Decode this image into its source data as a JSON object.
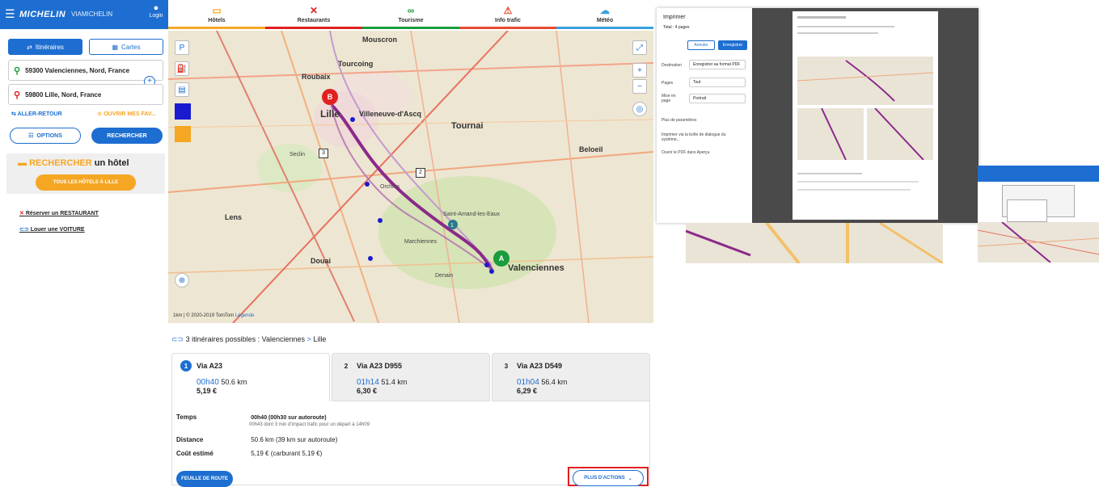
{
  "header": {
    "menu_icon": "hamburger-icon",
    "brand": "MICHELIN",
    "brand_suffix": "VIAMICHELIN",
    "login": "Login"
  },
  "mode_tabs": [
    {
      "label": "Itinéraires",
      "icon": "route-icon"
    },
    {
      "label": "Cartes",
      "icon": "map-icon"
    }
  ],
  "from": "59300 Valenciennes, Nord, France",
  "to": "59800 Lille, Nord, France",
  "roundtrip": "ALLER-RETOUR",
  "open_favorites": "OUVRIR MES FAV...",
  "options": "OPTIONS",
  "search": "RECHERCHER",
  "hotel": {
    "prefix": "RECHERCHER",
    "suffix": "un hôtel",
    "button": "TOUS LES HÔTELS À LILLE"
  },
  "links": [
    {
      "label": "Réserver un RESTAURANT",
      "icon": "restaurant-icon"
    },
    {
      "label": "Louer une VOITURE",
      "icon": "car-icon"
    }
  ],
  "nav": [
    {
      "label": "Hôtels",
      "color": "#f5a623"
    },
    {
      "label": "Restaurants",
      "color": "#e02020"
    },
    {
      "label": "Tourisme",
      "color": "#1a9c3c"
    },
    {
      "label": "Info trafic",
      "color": "#e84a2f"
    },
    {
      "label": "Météo",
      "color": "#3aa0e0"
    }
  ],
  "map_labels": {
    "mouscron": "Mouscron",
    "tourcoing": "Tourcoing",
    "roubaix": "Roubaix",
    "lille": "Lille",
    "villeneuve": "Villeneuve-d'Ascq",
    "tournai": "Tournai",
    "beloeil": "Beloeil",
    "valenciennes": "Valenciennes",
    "douai": "Douai",
    "lens": "Lens",
    "orchies": "Orchies",
    "marchiennes": "Marchiennes",
    "denain": "Denain",
    "saint_amand": "Saint-Amand-les-Eaux",
    "seclin": "Seclin",
    "attribution": "© 2020-2019 TomTom",
    "legend": "Légende",
    "scale": "1km"
  },
  "route_summary": {
    "count_text": "3 itinéraires possibles : Valenciennes",
    "dest": "Lille"
  },
  "routes": [
    {
      "n": "1",
      "via": "Via A23",
      "time": "00h40",
      "dist": "50.6 km",
      "cost": "5,19 €"
    },
    {
      "n": "2",
      "via": "Via A23 D955",
      "time": "01h14",
      "dist": "51.4 km",
      "cost": "6,30 €"
    },
    {
      "n": "3",
      "via": "Via A23 D549",
      "time": "01h04",
      "dist": "56.4 km",
      "cost": "6,29 €"
    }
  ],
  "details": {
    "time_k": "Temps",
    "time_v": "00h40 (00h30 sur autoroute)",
    "time_sub": "00h43 dont 3 min d'impact trafic pour un départ à 14h09",
    "dist_k": "Distance",
    "dist_v": "50.6 km (39 km sur autoroute)",
    "cost_k": "Coût estimé",
    "cost_v": "5,19 € (carburant 5,19 €)"
  },
  "roadbook": "FEUILLE DE ROUTE",
  "more_actions": "PLUS D'ACTIONS",
  "print": {
    "title": "Imprimer",
    "total": "Total : 4 pages",
    "cancel": "Annuler",
    "save": "Enregistrer",
    "dest_k": "Destination",
    "dest_v": "Enregistrer au format PDF",
    "pages_k": "Pages",
    "pages_v": "Tout",
    "layout_k": "Mise en page",
    "layout_v": "Portrait",
    "more_settings": "Plus de paramètres",
    "system_dialog": "Imprimer via la boîte de dialogue du système...",
    "open_pdf": "Ouvrir le PDF dans Aperçu"
  },
  "colors": {
    "brand": "#1d6ed0",
    "hotel_orange": "#f5a623",
    "route": "#8b2a8b",
    "alert": "#e02020"
  }
}
